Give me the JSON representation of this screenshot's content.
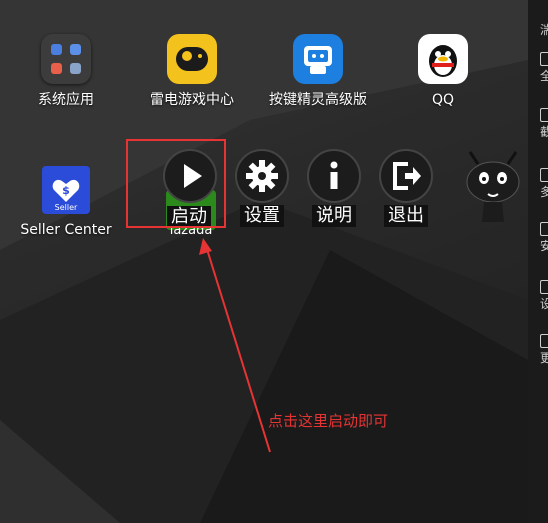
{
  "home_apps": [
    {
      "label": "系统应用"
    },
    {
      "label": "雷电游戏中心"
    },
    {
      "label": "按键精灵高级版"
    },
    {
      "label": "QQ"
    },
    {
      "label": "Seller Center"
    }
  ],
  "lazada_label": "lazada",
  "overlay": {
    "start_label": "启动",
    "settings_label": "设置",
    "help_label": "说明",
    "exit_label": "退出"
  },
  "annotation": "点击这里启动即可",
  "sidebar_items": [
    {
      "label": "湍"
    },
    {
      "label": "全"
    },
    {
      "label": "截"
    },
    {
      "label": "多"
    },
    {
      "label": "安"
    },
    {
      "label": "设"
    },
    {
      "label": "更"
    }
  ],
  "colors": {
    "annotation_red": "#e63434",
    "leidian_yellow": "#f4c21d",
    "anjian_blue": "#1d7fe0",
    "seller_blue": "#2b4bd9",
    "lazada_green": "#2c8a1c"
  }
}
